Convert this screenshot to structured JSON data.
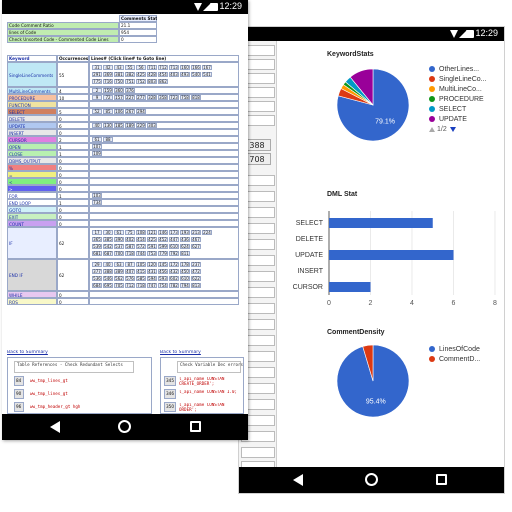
{
  "status_bar": {
    "time": "12:29"
  },
  "back_screen": {
    "left_numbers": [
      "388",
      "708"
    ],
    "charts": [
      {
        "title": "KeywordStats",
        "type": "pie",
        "slice_label": "79.1%",
        "legend": [
          "OtherLines...",
          "SingleLineCo...",
          "MultiLineCo...",
          "PROCEDURE",
          "SELECT",
          "UPDATE"
        ],
        "pager": "1/2"
      },
      {
        "title": "DML Stat",
        "type": "bar",
        "categories": [
          "SELECT",
          "DELETE",
          "UPDATE",
          "INSERT",
          "CURSOR"
        ],
        "ticks": [
          "0",
          "2",
          "4",
          "6",
          "8"
        ]
      },
      {
        "title": "CommentDensity",
        "type": "pie",
        "slice_label": "95.4%",
        "legend": [
          "LinesOfCode",
          "CommentD..."
        ]
      }
    ],
    "colors": {
      "blue": "#3366cc",
      "red": "#dc3912",
      "orange": "#ff9900",
      "green": "#109618",
      "purple": "#990099",
      "teal": "#0099c6",
      "pink": "#dd4477",
      "lime": "#66aa00"
    }
  },
  "chart_data": [
    {
      "type": "pie",
      "title": "KeywordStats",
      "categories": [
        "OtherLines...",
        "SingleLineCo...",
        "MultiLineCo...",
        "PROCEDURE",
        "SELECT",
        "UPDATE"
      ],
      "values": [
        79.1,
        3.5,
        2.0,
        1.5,
        3.0,
        10.9
      ],
      "labels_shown": [
        "79.1%"
      ]
    },
    {
      "type": "bar",
      "title": "DML Stat",
      "categories": [
        "SELECT",
        "DELETE",
        "UPDATE",
        "INSERT",
        "CURSOR"
      ],
      "values": [
        5,
        0,
        6,
        0,
        2
      ],
      "xlim": [
        0,
        8
      ]
    },
    {
      "type": "pie",
      "title": "CommentDensity",
      "categories": [
        "LinesOfCode",
        "CommentD..."
      ],
      "values": [
        95.4,
        4.6
      ],
      "labels_shown": [
        "95.4%"
      ]
    }
  ],
  "front_screen": {
    "summary_header": "Comments Stat",
    "summary_rows": [
      {
        "label": "Code Comment Ratio",
        "value": "21.1"
      },
      {
        "label": "lines of Code",
        "value": "954"
      },
      {
        "label": "Check Unsorted Code - Commented Code Lines",
        "value": "0"
      }
    ],
    "table_headers": [
      "Keyword",
      "Occurrences",
      "Lines# (Click line# to Goto line)"
    ],
    "keywords": [
      {
        "name": "SingleLineComments",
        "count": "55",
        "color": "#bfe8f5"
      },
      {
        "name": "MultiLineComments",
        "count": "4",
        "color": "#bfe8f5"
      },
      {
        "name": "PROCEDURE",
        "count": "10",
        "color": "#f7c1a0"
      },
      {
        "name": "FUNCTION",
        "count": "",
        "color": "#f0e3a0"
      },
      {
        "name": "SELECT",
        "count": "5",
        "color": "#d08060"
      },
      {
        "name": "DELETE",
        "count": "0",
        "color": "#e8e8e8"
      },
      {
        "name": "UPDATE",
        "count": "6",
        "color": "#b0c8f0"
      },
      {
        "name": "INSERT",
        "count": "0",
        "color": "#e8e8e8"
      },
      {
        "name": "CURSOR",
        "count": "2",
        "color": "#e080e0"
      },
      {
        "name": "OPEN",
        "count": "1",
        "color": "#b8f0b0"
      },
      {
        "name": "CLOSE",
        "count": "1",
        "color": "#b8f0b0"
      },
      {
        "name": "DBMS_OUTPUT",
        "count": "0",
        "color": "#e8e8e8"
      },
      {
        "name": "%",
        "count": "0",
        "color": "#f08080"
      },
      {
        "name": "=",
        "count": "0",
        "color": "#f0f080"
      },
      {
        "name": "<",
        "count": "0",
        "color": "#80f080"
      },
      {
        "name": ">",
        "count": "0",
        "color": "#6060f0"
      },
      {
        "name": "FOR",
        "count": "1",
        "color": "#ffffff"
      },
      {
        "name": "END LOOP",
        "count": "1",
        "color": "#ffffff"
      },
      {
        "name": "GOTO",
        "count": "0",
        "color": "#d0f0f8"
      },
      {
        "name": "EXIT",
        "count": "0",
        "color": "#c8f0c0"
      },
      {
        "name": "COUNT",
        "count": "0",
        "color": "#c8a0f0"
      },
      {
        "name": "IF",
        "count": "62",
        "color": "#e8eeff"
      },
      {
        "name": "END IF",
        "count": "62",
        "color": "#d8d8d8"
      },
      {
        "name": "WHILE",
        "count": "0",
        "color": "#e8c8f0"
      },
      {
        "name": "ROS",
        "count": "0",
        "color": "#f8f8c8"
      }
    ],
    "line_numbers": {
      "single_line": [
        [
          "31",
          "42",
          "43",
          "55",
          "56",
          "711",
          "712",
          "713",
          "160",
          "166",
          "167"
        ],
        [
          "291",
          "369",
          "381",
          "382",
          "425",
          "428",
          "454",
          "403",
          "493",
          "540",
          "541"
        ],
        [
          "775",
          "716",
          "750",
          "751",
          "752",
          "803",
          "862"
        ]
      ],
      "multi_line": [
        [
          "2",
          "159",
          "360",
          "376"
        ]
      ],
      "procedure": [
        [
          "9",
          "72",
          "157",
          "227",
          "277",
          "328",
          "358",
          "723",
          "758",
          "818"
        ]
      ],
      "select": [
        [
          "52",
          "85",
          "106",
          "267",
          "294"
        ]
      ],
      "update": [
        [
          "40",
          "130",
          "185",
          "189",
          "229",
          "303"
        ]
      ],
      "cursor": [
        [
          "61",
          "88"
        ]
      ],
      "open": [
        [
          "107"
        ]
      ],
      "close": [
        [
          "109"
        ]
      ],
      "for": [
        [
          "103"
        ]
      ],
      "end_loop": [
        [
          "734"
        ]
      ],
      "if": [
        [
          "17",
          "30",
          "61",
          "75",
          "108",
          "121",
          "146",
          "173",
          "193",
          "213",
          "224"
        ],
        [
          "365",
          "385",
          "390",
          "402",
          "414",
          "425",
          "452",
          "447",
          "436",
          "467"
        ],
        [
          "539",
          "542",
          "537",
          "587",
          "572",
          "591",
          "599",
          "610",
          "624",
          "627"
        ],
        [
          "681",
          "687",
          "700",
          "718",
          "744",
          "753",
          "779",
          "792",
          "811"
        ]
      ],
      "end_if": [
        [
          "29",
          "40",
          "63",
          "87",
          "105",
          "120",
          "145",
          "172",
          "178",
          "237"
        ],
        [
          "377",
          "388",
          "389",
          "407",
          "415",
          "431",
          "456",
          "432",
          "450",
          "472"
        ],
        [
          "536",
          "546",
          "562",
          "576",
          "585",
          "594",
          "593",
          "602",
          "610",
          "622"
        ],
        [
          "684",
          "695",
          "705",
          "712",
          "718",
          "747",
          "754",
          "782",
          "794",
          "813"
        ]
      ]
    },
    "bottom_left": {
      "link": "Back to Summary",
      "header": "Table References - Check Redundant Selects",
      "rows": [
        {
          "line": "84",
          "code": "ww_tmp_lines_gt"
        },
        {
          "line": "90",
          "code": "ww_tmp_lines_gt"
        },
        {
          "line": "96",
          "code": "ww_tmp_header_gt hgh"
        }
      ]
    },
    "bottom_right": {
      "link": "Back to Summary",
      "header": "Check Variable Dec errors",
      "rows": [
        {
          "line": "345",
          "code": "l_api_name CONSTAN CREATE_ORDER';"
        },
        {
          "line": "346",
          "code": "l_api_name CONSTAN 1.0;"
        },
        {
          "line": "350",
          "code": "l_api_name CONSTAN ORDER';"
        }
      ]
    }
  }
}
